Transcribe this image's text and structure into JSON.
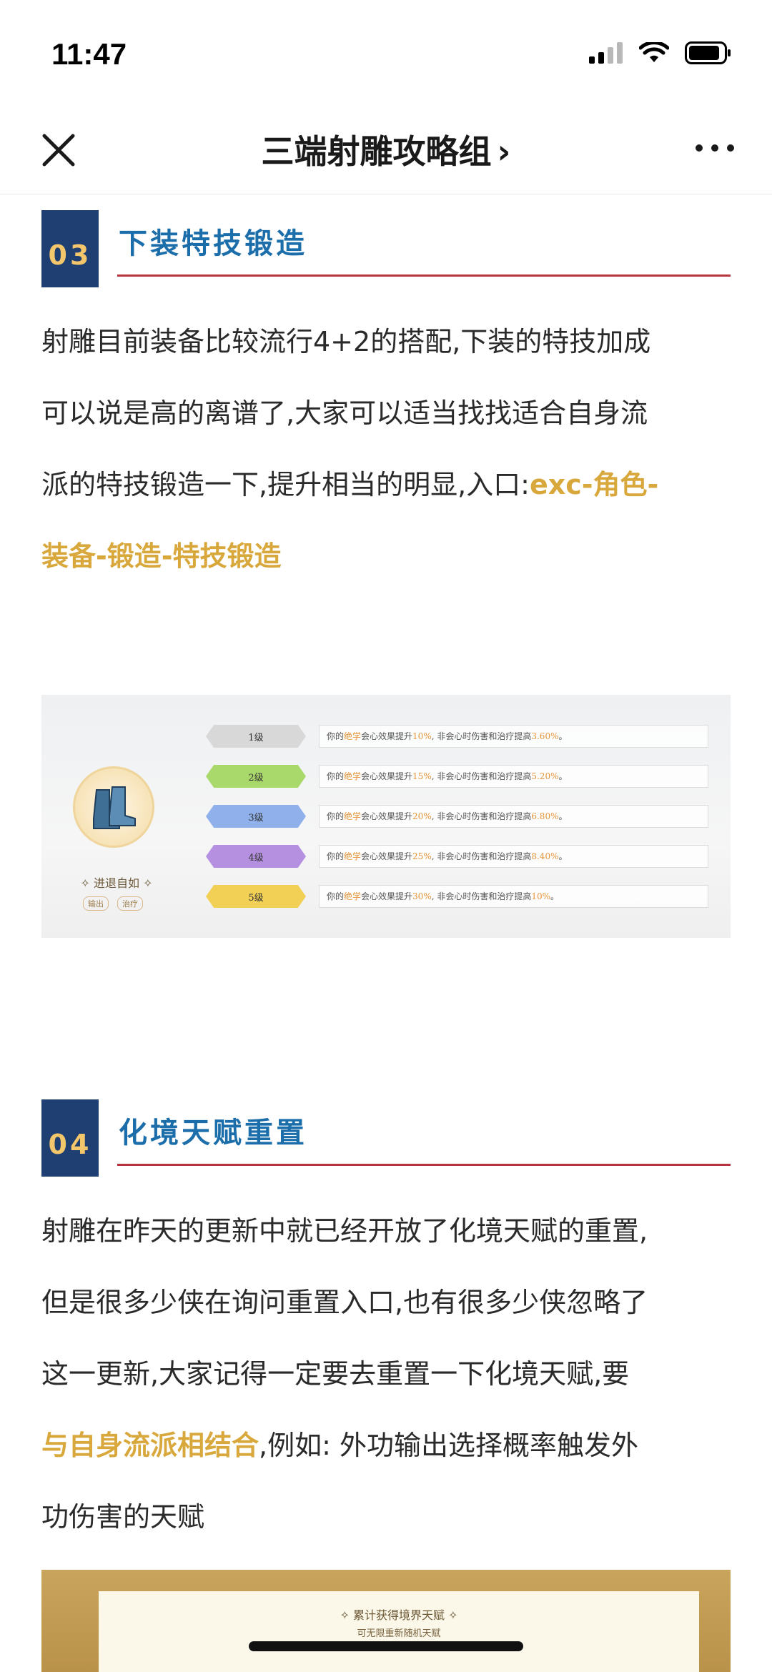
{
  "status": {
    "time": "11:47"
  },
  "nav": {
    "title": "三端射雕攻略组",
    "chevron": "›"
  },
  "sections": [
    {
      "num": "03",
      "title": "下装特技锻造",
      "lines": [
        "射雕目前装备比较流行4+2的搭配,下装的特技加成",
        "可以说是高的离谱了,大家可以适当找找适合自身流"
      ],
      "line3_plain": "派的特技锻造一下,提升相当的明显,入口:",
      "line3_hl": "exc-角色-",
      "line4_hl": "装备-锻造-特技锻造"
    },
    {
      "num": "04",
      "title": "化境天赋重置",
      "lines": [
        "射雕在昨天的更新中就已经开放了化境天赋的重置,",
        "但是很多少侠在询问重置入口,也有很多少侠忽略了",
        "这一更新,大家记得一定要去重置一下化境天赋,要"
      ],
      "line4_hl": "与自身流派相结合",
      "line4_plain": ",例如: 外功输出选择概率触发外",
      "line5": "功伤害的天赋"
    }
  ],
  "forge_image": {
    "item_name": "✧ 进退自如 ✧",
    "tags": [
      "输出",
      "治疗"
    ],
    "levels": [
      {
        "label": "1级",
        "color": "#d8d8d8",
        "pre": "你的",
        "skill": "绝学",
        "mid": "会心效果提升",
        "pct": "10%",
        "post": ", 非会心时伤害和治疗提高",
        "val": "3.60%",
        "end": "。"
      },
      {
        "label": "2级",
        "color": "#a9d86b",
        "pre": "你的",
        "skill": "绝学",
        "mid": "会心效果提升",
        "pct": "15%",
        "post": ", 非会心时伤害和治疗提高",
        "val": "5.20%",
        "end": "。"
      },
      {
        "label": "3级",
        "color": "#8fb0ea",
        "pre": "你的",
        "skill": "绝学",
        "mid": "会心效果提升",
        "pct": "20%",
        "post": ", 非会心时伤害和治疗提高",
        "val": "6.80%",
        "end": "。"
      },
      {
        "label": "4级",
        "color": "#b590e0",
        "pre": "你的",
        "skill": "绝学",
        "mid": "会心效果提升",
        "pct": "25%",
        "post": ", 非会心时伤害和治疗提高",
        "val": "8.40%",
        "end": "。"
      },
      {
        "label": "5级",
        "color": "#f2cf55",
        "pre": "你的",
        "skill": "绝学",
        "mid": "会心效果提升",
        "pct": "30%",
        "post": ", 非会心时伤害和治疗提高",
        "val": "10%",
        "end": "。"
      }
    ]
  },
  "talent_image": {
    "title": "✧ 累计获得境界天赋 ✧",
    "subtitle": "可无限重新随机天赋"
  },
  "colors": {
    "accent_blue": "#1c6eaa",
    "badge_navy": "#1f3f73",
    "highlight_gold": "#d9a83c",
    "rule_red": "#b8333b"
  }
}
